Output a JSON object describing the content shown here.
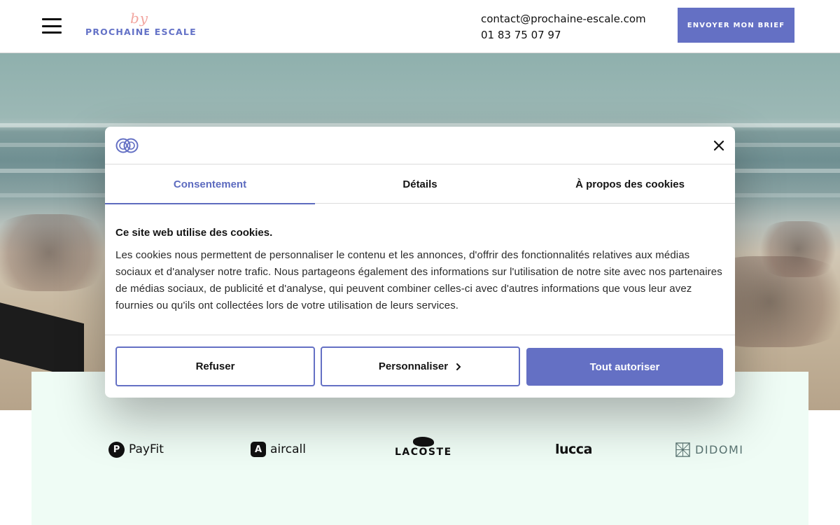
{
  "header": {
    "brand_script": "by",
    "brand_name": "PROCHAINE ESCALE",
    "email": "contact@prochaine-escale.com",
    "phone": "01 83 75 07 97",
    "cta_label": "ENVOYER MON BRIEF"
  },
  "clients": {
    "payfit": {
      "icon_letter": "P",
      "name": "PayFit"
    },
    "aircall": {
      "icon_letter": "A",
      "name": "aircall"
    },
    "lacoste": {
      "name": "LACOSTE"
    },
    "lucca": {
      "name": "lucca"
    },
    "didomi": {
      "name": "DIDOMI"
    }
  },
  "cookie_dialog": {
    "tabs": [
      {
        "label": "Consentement",
        "active": true
      },
      {
        "label": "Détails",
        "active": false
      },
      {
        "label": "À propos des cookies",
        "active": false
      }
    ],
    "title": "Ce site web utilise des cookies.",
    "body": "Les cookies nous permettent de personnaliser le contenu et les annonces, d'offrir des fonctionnalités relatives aux médias sociaux et d'analyser notre trafic. Nous partageons également des informations sur l'utilisation de notre site avec nos partenaires de médias sociaux, de publicité et d'analyse, qui peuvent combiner celles-ci avec d'autres informations que vous leur avez fournies ou qu'ils ont collectées lors de votre utilisation de leurs services.",
    "buttons": {
      "refuse": "Refuser",
      "customize": "Personnaliser",
      "accept": "Tout autoriser"
    }
  },
  "colors": {
    "accent": "#6470c4",
    "tab_active": "#5d6bbf",
    "logo_pink": "#f2a6a0",
    "logos_band_bg": "#effcf5"
  },
  "icons": [
    "menu-icon",
    "cookiebot-logo-icon",
    "close-icon",
    "chevron-right-icon",
    "payfit-logo-icon",
    "aircall-logo-icon",
    "lacoste-crocodile-icon",
    "didomi-logo-icon"
  ]
}
